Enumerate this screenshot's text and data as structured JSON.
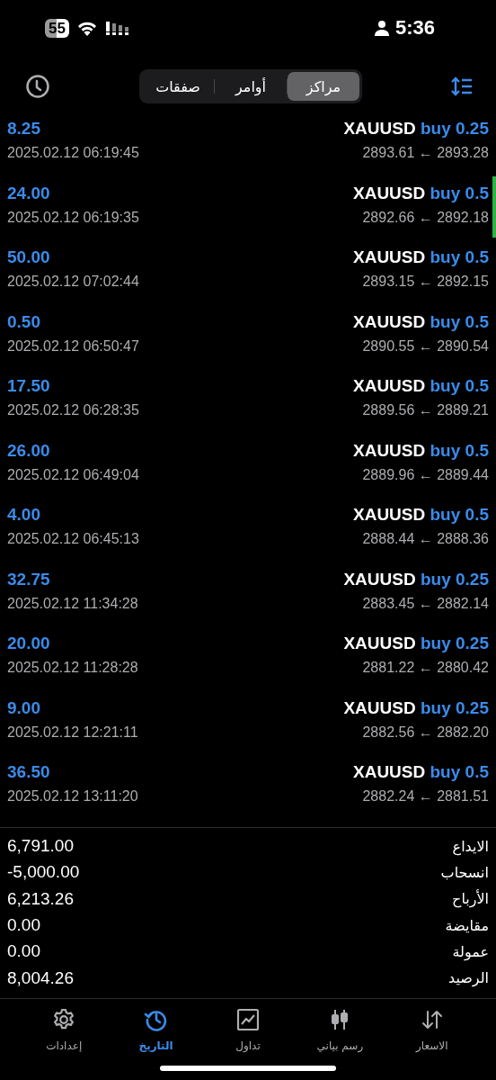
{
  "status_bar": {
    "battery": "55",
    "time": "5:36"
  },
  "segments": [
    {
      "label": "مراكز",
      "selected": true
    },
    {
      "label": "أوامر",
      "selected": false
    },
    {
      "label": "صفقات",
      "selected": false
    }
  ],
  "deals": [
    {
      "profit": "8.25",
      "time": "2025.02.12 06:19:45",
      "symbol": "XAUUSD",
      "type": "buy",
      "volume": "0.25",
      "prices": "2893.61 ← 2893.28"
    },
    {
      "profit": "24.00",
      "time": "2025.02.12 06:19:35",
      "symbol": "XAUUSD",
      "type": "buy",
      "volume": "0.5",
      "prices": "2892.66 ← 2892.18"
    },
    {
      "profit": "50.00",
      "time": "2025.02.12 07:02:44",
      "symbol": "XAUUSD",
      "type": "buy",
      "volume": "0.5",
      "prices": "2893.15 ← 2892.15"
    },
    {
      "profit": "0.50",
      "time": "2025.02.12 06:50:47",
      "symbol": "XAUUSD",
      "type": "buy",
      "volume": "0.5",
      "prices": "2890.55 ← 2890.54"
    },
    {
      "profit": "17.50",
      "time": "2025.02.12 06:28:35",
      "symbol": "XAUUSD",
      "type": "buy",
      "volume": "0.5",
      "prices": "2889.56 ← 2889.21"
    },
    {
      "profit": "26.00",
      "time": "2025.02.12 06:49:04",
      "symbol": "XAUUSD",
      "type": "buy",
      "volume": "0.5",
      "prices": "2889.96 ← 2889.44"
    },
    {
      "profit": "4.00",
      "time": "2025.02.12 06:45:13",
      "symbol": "XAUUSD",
      "type": "buy",
      "volume": "0.5",
      "prices": "2888.44 ← 2888.36"
    },
    {
      "profit": "32.75",
      "time": "2025.02.12 11:34:28",
      "symbol": "XAUUSD",
      "type": "buy",
      "volume": "0.25",
      "prices": "2883.45 ← 2882.14"
    },
    {
      "profit": "20.00",
      "time": "2025.02.12 11:28:28",
      "symbol": "XAUUSD",
      "type": "buy",
      "volume": "0.25",
      "prices": "2881.22 ← 2880.42"
    },
    {
      "profit": "9.00",
      "time": "2025.02.12 12:21:11",
      "symbol": "XAUUSD",
      "type": "buy",
      "volume": "0.25",
      "prices": "2882.56 ← 2882.20"
    },
    {
      "profit": "36.50",
      "time": "2025.02.12 13:11:20",
      "symbol": "XAUUSD",
      "type": "buy",
      "volume": "0.5",
      "prices": "2882.24 ← 2881.51"
    }
  ],
  "summary": [
    {
      "label": "الايداع",
      "value": "6,791.00"
    },
    {
      "label": "انسحاب",
      "value": "-5,000.00"
    },
    {
      "label": "الأرباح",
      "value": "6,213.26"
    },
    {
      "label": "مقايضة",
      "value": "0.00"
    },
    {
      "label": "عمولة",
      "value": "0.00"
    },
    {
      "label": "الرصيد",
      "value": "8,004.26"
    }
  ],
  "tab_bar": [
    {
      "kind": "quotes",
      "label": "الاسعار",
      "selected": false
    },
    {
      "kind": "chart",
      "label": "رسم بياني",
      "selected": false
    },
    {
      "kind": "trade",
      "label": "تداول",
      "selected": false
    },
    {
      "kind": "history",
      "label": "التاريخ",
      "selected": true
    },
    {
      "kind": "settings",
      "label": "إعدادات",
      "selected": false
    }
  ]
}
